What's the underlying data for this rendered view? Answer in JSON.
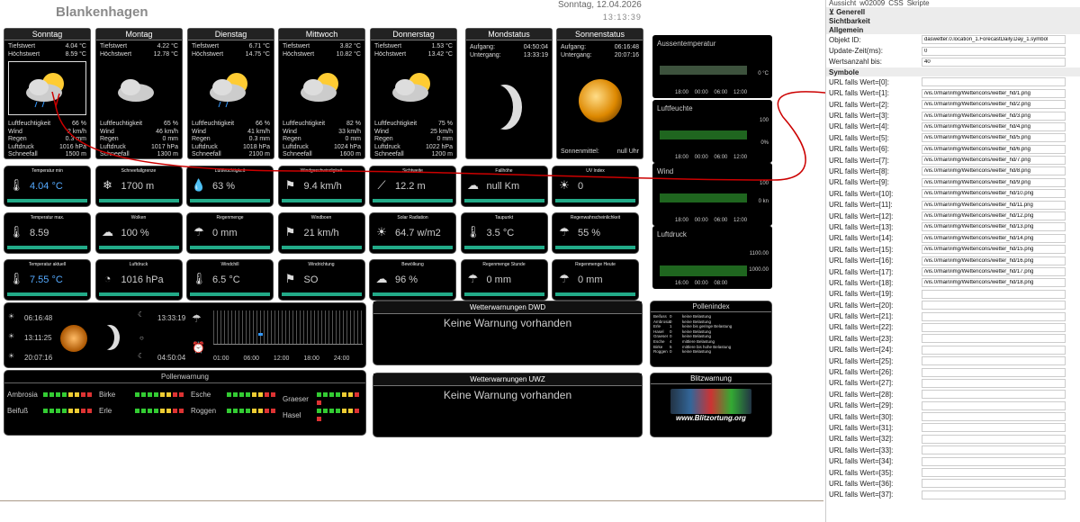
{
  "header": {
    "title": "Blankenhagen",
    "date": "Sonntag, 12.04.2026",
    "time": "13:13:39"
  },
  "days": [
    {
      "name": "Sonntag",
      "tmin": "4.04 °C",
      "tmax": "8.59 °C",
      "hum": "66 %",
      "wind": "2 km/h",
      "rain": "0.3 mm",
      "press": "1016 hPa",
      "snow": "1500 m",
      "icon": "cloud-sun-rain-icon"
    },
    {
      "name": "Montag",
      "tmin": "4.22 °C",
      "tmax": "12.78 °C",
      "hum": "65 %",
      "wind": "46 km/h",
      "rain": "0 mm",
      "press": "1017 hPa",
      "snow": "1300 m",
      "icon": "cloud-icon"
    },
    {
      "name": "Dienstag",
      "tmin": "6.71 °C",
      "tmax": "14.75 °C",
      "hum": "66 %",
      "wind": "41 km/h",
      "rain": "0.3 mm",
      "press": "1018 hPa",
      "snow": "2100 m",
      "icon": "cloud-sun-rain-icon"
    },
    {
      "name": "Mittwoch",
      "tmin": "3.82 °C",
      "tmax": "10.82 °C",
      "hum": "82 %",
      "wind": "33 km/h",
      "rain": "0 mm",
      "press": "1024 hPa",
      "snow": "1600 m",
      "icon": "cloud-sun-icon"
    },
    {
      "name": "Donnerstag",
      "tmin": "1.53 °C",
      "tmax": "13.42 °C",
      "hum": "75 %",
      "wind": "25 km/h",
      "rain": "0 mm",
      "press": "1022 hPa",
      "snow": "1200 m",
      "icon": "sun-cloud-icon"
    }
  ],
  "labels": {
    "tmin": "Tiefstwert",
    "tmax": "Höchstwert",
    "hum": "Luftfeuchtigkeit",
    "wind": "Wind",
    "rain": "Regen",
    "press": "Luftdruck",
    "snow": "Schneefall",
    "rise": "Aufgang:",
    "set": "Untergang:",
    "noon": "Sonnenmittel:"
  },
  "moon": {
    "title": "Mondstatus",
    "rise": "04:50:04",
    "set": "13:33:19"
  },
  "sun": {
    "title": "Sonnenstatus",
    "rise": "06:16:48",
    "set": "20:07:16",
    "noon": "null Uhr"
  },
  "graphs": [
    {
      "label": "Aussentemperatur",
      "unit": "0 °C",
      "ticks": "18:00 00:00 06:00 12:00"
    },
    {
      "label": "Luftfeuchte",
      "unit": "100",
      "unit2": "0%",
      "ticks": "18:00 00:00 06:00 12:00"
    },
    {
      "label": "Wind",
      "unit": "100",
      "unit2": "0 kn",
      "ticks": "18:00 00:00 06:00 12:00"
    },
    {
      "label": "Luftdruck",
      "unit": "1100.00",
      "unit2": "1000.00",
      "ticks": "16:00 00:00 08:00"
    }
  ],
  "tiles": [
    {
      "t": "Temperatur min",
      "v": "4.04 °C",
      "color": "#5af"
    },
    {
      "t": "Schneefallgrenze",
      "v": "1700 m"
    },
    {
      "t": "Luftfeuchtigkeit",
      "v": "63 %"
    },
    {
      "t": "Windgeschwindigkeit",
      "v": "9.4 km/h"
    },
    {
      "t": "Sichtweite",
      "v": "12.2 m"
    },
    {
      "t": "Fallhöhe",
      "v": "null Km"
    },
    {
      "t": "UV Index",
      "v": "0"
    },
    {
      "t": "Temperatur max.",
      "v": "8.59"
    },
    {
      "t": "Wolken",
      "v": "100 %"
    },
    {
      "t": "Regenmenge",
      "v": "0 mm"
    },
    {
      "t": "Windboen",
      "v": "21 km/h"
    },
    {
      "t": "Solar Radiation",
      "v": "64.7 w/m2"
    },
    {
      "t": "Taupunkt",
      "v": "3.5 °C"
    },
    {
      "t": "Regenwahrscheinlichkeit",
      "v": "55 %"
    },
    {
      "t": "Temperatur aktuell",
      "v": "7.55 °C",
      "color": "#5af"
    },
    {
      "t": "Luftdruck",
      "v": "1016 hPa"
    },
    {
      "t": "Windchill",
      "v": "6.5 °C"
    },
    {
      "t": "Windrichtung",
      "v": "SO"
    },
    {
      "t": "Bewölkung",
      "v": "96 %"
    },
    {
      "t": "Regenmenge Stunde",
      "v": "0 mm"
    },
    {
      "t": "Regenmenge Heute",
      "v": "0 mm"
    }
  ],
  "astro": {
    "sunrise": "06:16:48",
    "suntime": "13:11:25",
    "sunset": "20:07:16",
    "moonset": "13:33:19",
    "moonrise": "04:50:04",
    "axis": "01:00 06:00 12:00 18:00 24:00"
  },
  "pollen": {
    "title": "Pollenwarnung",
    "items": [
      "Ambrosia",
      "Birke",
      "Esche",
      "Graeser",
      "Beifuß",
      "Erle",
      "Roggen",
      "Hasel"
    ]
  },
  "dwd": {
    "title": "Wetterwarnungen DWD",
    "text": "Keine Warnung vorhanden"
  },
  "uwz": {
    "title": "Wetterwarnungen UWZ",
    "text": "Keine Warnung vorhanden"
  },
  "pollenindex": {
    "title": "Pollenindex",
    "rows": [
      [
        "Beifuss",
        "0",
        "keine Belastung"
      ],
      [
        "Ambrosia",
        "0",
        "keine Belastung"
      ],
      [
        "Erle",
        "1",
        "keine bis geringe Belastung"
      ],
      [
        "Hasel",
        "0",
        "keine Belastung"
      ],
      [
        "Graeser",
        "0",
        "keine Belastung"
      ],
      [
        "Esche",
        "4",
        "mittlere Belastung"
      ],
      [
        "Birke",
        "5",
        "mittlere bis hohe Belastung"
      ],
      [
        "Roggen",
        "0",
        "keine Belastung"
      ]
    ]
  },
  "blitz": {
    "title": "Blitzwarnung",
    "url": "www.Blitzortung.org"
  },
  "sidebar": {
    "tabs": [
      "Aussicht",
      "w02009",
      "CSS",
      "Skripte"
    ],
    "sections": [
      "Generell",
      "Sichtbarkeit",
      "Allgemein"
    ],
    "objekt_label": "Objekt ID:",
    "objekt_value": "daswetter.0.location_1.ForecastDaily.Day_1.symbol",
    "update_label": "Update-Zeit(ms):",
    "update_value": "0",
    "count_label": "Wertsanzahl bis:",
    "count_value": "40",
    "symbole": "Symbole",
    "url_prefix": "URL falls Wert=[",
    "urls": [
      "",
      "/vis.0/main/img/Wettericons/wetter_hd/1.png",
      "/vis.0/main/img/Wettericons/wetter_hd/2.png",
      "/vis.0/main/img/Wettericons/wetter_hd/3.png",
      "/vis.0/main/img/Wettericons/wetter_hd/4.png",
      "/vis.0/main/img/Wettericons/wetter_hd/5.png",
      "/vis.0/main/img/Wettericons/wetter_hd/6.png",
      "/vis.0/main/img/Wettericons/wetter_hd/7.png",
      "/vis.0/main/img/Wettericons/wetter_hd/8.png",
      "/vis.0/main/img/Wettericons/wetter_hd/9.png",
      "/vis.0/main/img/Wettericons/wetter_hd/10.png",
      "/vis.0/main/img/Wettericons/wetter_hd/11.png",
      "/vis.0/main/img/Wettericons/wetter_hd/12.png",
      "/vis.0/main/img/Wettericons/wetter_hd/13.png",
      "/vis.0/main/img/Wettericons/wetter_hd/14.png",
      "/vis.0/main/img/Wettericons/wetter_hd/15.png",
      "/vis.0/main/img/Wettericons/wetter_hd/16.png",
      "/vis.0/main/img/Wettericons/wetter_hd/17.png",
      "/vis.0/main/img/Wettericons/wetter_hd/18.png",
      "",
      "",
      "",
      "",
      "",
      "",
      "",
      "",
      "",
      "",
      "",
      "",
      "",
      "",
      "",
      "",
      "",
      "",
      ""
    ]
  }
}
